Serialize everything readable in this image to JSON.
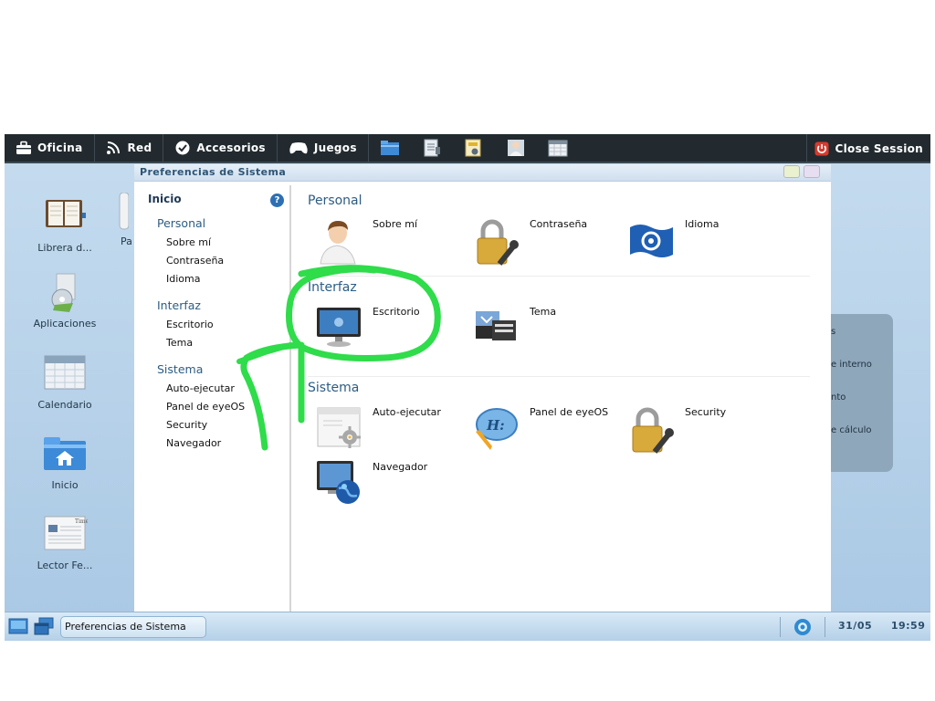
{
  "topbar": {
    "menus": [
      {
        "label": "Oficina",
        "icon": "briefcase-icon"
      },
      {
        "label": "Red",
        "icon": "rss-icon"
      },
      {
        "label": "Accesorios",
        "icon": "checkmark-icon"
      },
      {
        "label": "Juegos",
        "icon": "gamepad-icon"
      }
    ],
    "quick_icons": [
      "folder-icon",
      "document-icon",
      "id-card-icon",
      "user-icon",
      "calendar-icon"
    ],
    "close_session_label": "Close Session",
    "close_session_icon": "power-icon"
  },
  "desktop": {
    "icons": [
      {
        "label": "Librera d...",
        "icon": "book-icon"
      },
      {
        "label": "Aplicaciones",
        "icon": "applications-icon"
      },
      {
        "label": "Calendario",
        "icon": "calendar-icon"
      },
      {
        "label": "Inicio",
        "icon": "home-folder-icon"
      },
      {
        "label": "Lector Fe...",
        "icon": "newspaper-icon"
      }
    ],
    "partial_icon_label": "Pa"
  },
  "window": {
    "title": "Preferencias de Sistema",
    "sidebar": {
      "home_label": "Inicio",
      "help_icon": "help-icon",
      "categories": [
        {
          "label": "Personal",
          "items": [
            "Sobre mí",
            "Contraseña",
            "Idioma"
          ]
        },
        {
          "label": "Interfaz",
          "items": [
            "Escritorio",
            "Tema"
          ]
        },
        {
          "label": "Sistema",
          "items": [
            "Auto-ejecutar",
            "Panel de eyeOS",
            "Security",
            "Navegador"
          ]
        }
      ]
    },
    "main": {
      "sections": [
        {
          "title": "Personal",
          "items": [
            {
              "label": "Sobre mí",
              "icon": "user-avatar-icon"
            },
            {
              "label": "Contraseña",
              "icon": "padlock-key-icon"
            },
            {
              "label": "Idioma",
              "icon": "flag-icon"
            }
          ]
        },
        {
          "title": "Interfaz",
          "items": [
            {
              "label": "Escritorio",
              "icon": "monitor-icon"
            },
            {
              "label": "Tema",
              "icon": "theme-icon"
            }
          ]
        },
        {
          "title": "Sistema",
          "items": [
            {
              "label": "Auto-ejecutar",
              "icon": "autorun-gear-icon"
            },
            {
              "label": "Panel de eyeOS",
              "icon": "eyeos-panel-icon"
            },
            {
              "label": "Security",
              "icon": "padlock-key-icon"
            },
            {
              "label": "Navegador",
              "icon": "browser-globe-icon"
            }
          ]
        }
      ]
    }
  },
  "right_panel": {
    "items": [
      "s",
      "e interno",
      "nto",
      "e cálculo"
    ]
  },
  "taskbar": {
    "left_icons": [
      "show-desktop-icon",
      "windows-icon"
    ],
    "task_label": "Preferencias de Sistema",
    "tray_icon": "eyeos-icon",
    "date": "31/05",
    "time": "19:59"
  },
  "colors": {
    "topbar": "#222a2f",
    "desktop": "#b5d0e8",
    "accent_text": "#2c5d85",
    "annotation": "#2fdc4a"
  }
}
